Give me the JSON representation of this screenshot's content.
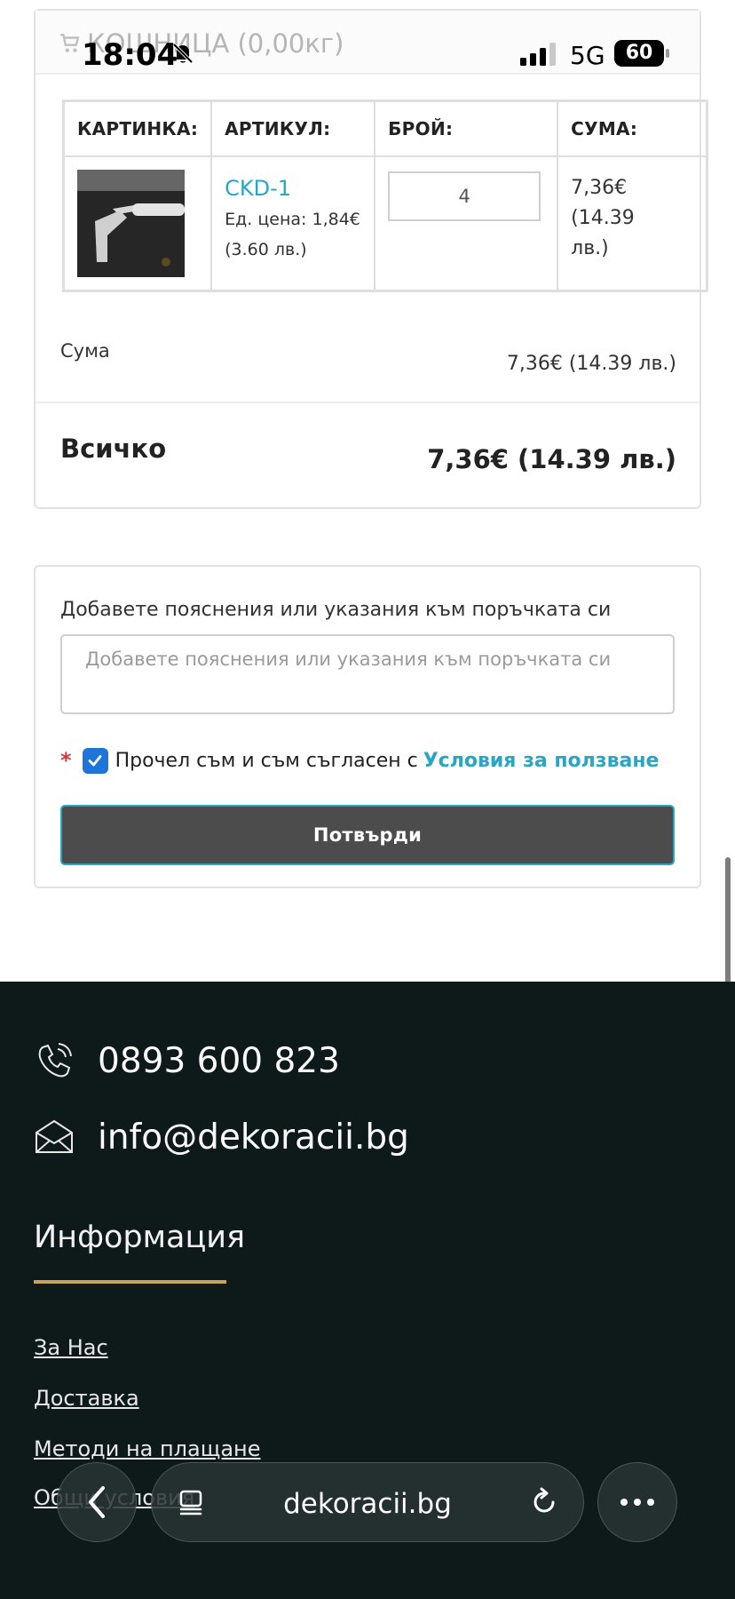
{
  "status_bar": {
    "time": "18:04",
    "network": "5G",
    "battery": "60"
  },
  "cart": {
    "heading": "КОШНИЦА (0,00кг)",
    "columns": {
      "image": "КАРТИНКА:",
      "article": "АРТИКУЛ:",
      "quantity": "БРОЙ:",
      "sum": "СУМА:"
    },
    "item": {
      "sku": "CKD-1",
      "unit_price": "Ед. цена: 1,84€",
      "unit_price_bgn": "(3.60 лв.)",
      "quantity": "4",
      "total_eur": "7,36€",
      "total_bgn_1": "(14.39",
      "total_bgn_2": "лв.)"
    },
    "subtotal_label": "Сума",
    "subtotal_value": "7,36€ (14.39 лв.)",
    "total_label": "Всичко",
    "total_value": "7,36€ (14.39 лв.)"
  },
  "notes": {
    "label": "Добавете пояснения или указания към поръчката си",
    "placeholder": "Добавете пояснения или указания към поръчката си",
    "value": ""
  },
  "terms": {
    "required_mark": "*",
    "text": "Прочел съм и съм съгласен с",
    "link": "Условия за ползване",
    "checked": true
  },
  "confirm_label": "Потвърди",
  "footer": {
    "phone": "0893 600 823",
    "email": "info@dekoracii.bg",
    "info_heading": "Информация",
    "links": [
      "За Нас",
      "Доставка",
      "Методи на плащане",
      "Общи условия"
    ],
    "accent_color": "#c9a35a",
    "background_color": "#0e1a1a"
  },
  "browser": {
    "url": "dekoracii.bg"
  }
}
